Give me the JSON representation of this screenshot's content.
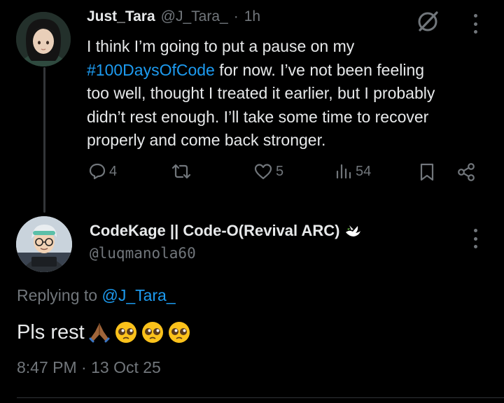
{
  "tweet": {
    "author_name": "Just_Tara",
    "author_handle": "@J_Tara_",
    "separator": "·",
    "time_ago": "1h",
    "text_line1": "I think I’m going to put a pause on my",
    "hashtag": "#100DaysOfCode",
    "text_after_hashtag": " for now. I’ve not been feeling",
    "text_line3": "too well, thought I treated it earlier, but I probably",
    "text_line4": "didn’t rest enough. I’ll take some time to recover",
    "text_line5": "properly and come back stronger.",
    "replies": "4",
    "likes": "5",
    "views": "54"
  },
  "reply": {
    "author_name": "CodeKage || Code-O(Revival ARC)",
    "author_handle": "@luqmanola60",
    "replying_prefix": "Replying to ",
    "replying_to": "@J_Tara_",
    "text": "Pls rest",
    "timestamp": "8:47 PM · 13 Oct 25"
  },
  "icons": [
    "reply-icon",
    "retweet-icon",
    "like-icon",
    "views-icon",
    "bookmark-icon",
    "share-icon",
    "grok-icon",
    "more-icon",
    "dove-icon",
    "folded-hands-emoji",
    "pleading-face-emoji"
  ],
  "colors": {
    "background": "#000000",
    "text": "#e7e9ea",
    "muted": "#71767b",
    "link": "#1d9bf0"
  }
}
